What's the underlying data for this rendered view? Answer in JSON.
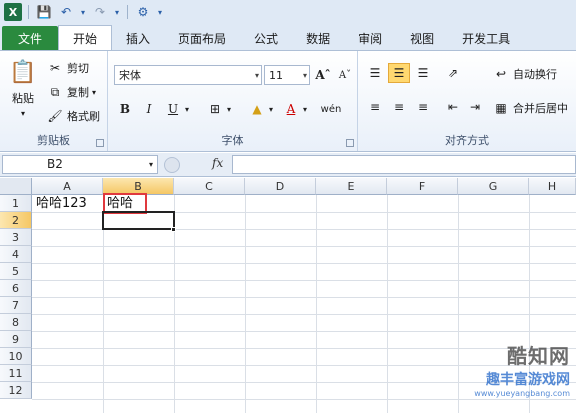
{
  "tabs": [
    "文件",
    "开始",
    "插入",
    "页面布局",
    "公式",
    "数据",
    "审阅",
    "视图",
    "开发工具"
  ],
  "active_tab": "开始",
  "clipboard": {
    "paste": "粘贴",
    "cut": "剪切",
    "copy": "复制",
    "painter": "格式刷",
    "label": "剪贴板"
  },
  "font": {
    "name": "宋体",
    "size": "11",
    "bold": "B",
    "italic": "I",
    "underline": "U",
    "label": "字体"
  },
  "alignment": {
    "wrap": "自动换行",
    "merge": "合并后居中",
    "label": "对齐方式"
  },
  "formula_bar": {
    "name_box": "B2",
    "fx": "fx",
    "value": ""
  },
  "grid": {
    "columns": [
      "A",
      "B",
      "C",
      "D",
      "E",
      "F",
      "G",
      "H"
    ],
    "rows": [
      "1",
      "2",
      "3",
      "4",
      "5",
      "6",
      "7",
      "8",
      "9",
      "10",
      "11",
      "12"
    ],
    "selected_column": "B",
    "selected_row": "2",
    "cells": {
      "A1": "哈哈123",
      "B1": "哈哈"
    }
  },
  "watermark": {
    "line1": "酷知网",
    "line2": "趣丰富游戏网",
    "line3": "www.yueyangbang.com"
  },
  "colors": {
    "file_tab": "#2a8a3e",
    "selection_header": "#f5c765",
    "highlight_box": "#e0393e"
  }
}
